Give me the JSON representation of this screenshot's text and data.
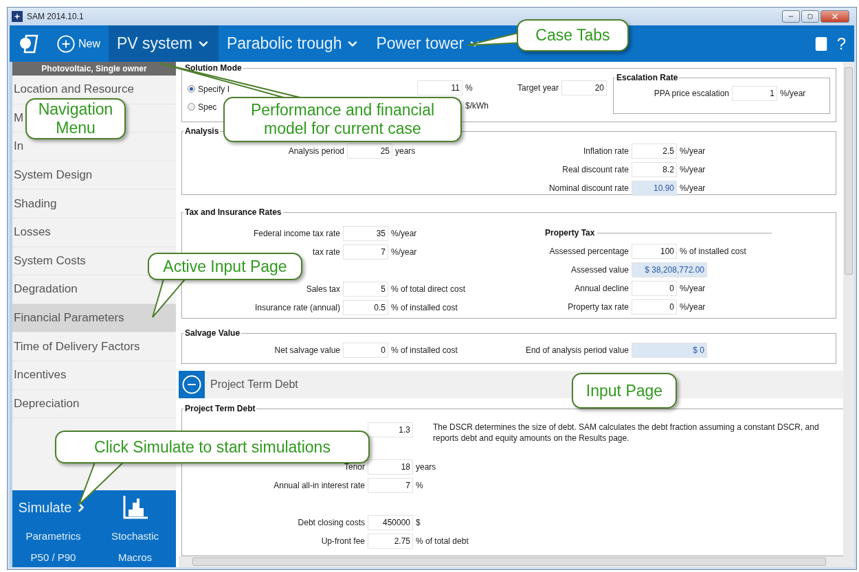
{
  "window": {
    "title": "SAM 2014.10.1"
  },
  "toolbar": {
    "new_label": "New",
    "help": "?",
    "cases": [
      {
        "label": "PV system",
        "selected": true
      },
      {
        "label": "Parabolic trough",
        "selected": false
      },
      {
        "label": "Power tower",
        "selected": false
      }
    ]
  },
  "sidebar": {
    "header": "Photovoltaic, Single owner",
    "items": [
      {
        "label": "Location and Resource",
        "selected": false
      },
      {
        "label": "M",
        "selected": false
      },
      {
        "label": "In",
        "selected": false
      },
      {
        "label": "System Design",
        "selected": false
      },
      {
        "label": "Shading",
        "selected": false
      },
      {
        "label": "Losses",
        "selected": false
      },
      {
        "label": "System Costs",
        "selected": false
      },
      {
        "label": "Degradation",
        "selected": false
      },
      {
        "label": "Financial Parameters",
        "selected": true
      },
      {
        "label": "Time of Delivery Factors",
        "selected": false
      },
      {
        "label": "Incentives",
        "selected": false
      },
      {
        "label": "Depreciation",
        "selected": false
      }
    ]
  },
  "simulate": {
    "label": "Simulate",
    "links": [
      "Parametrics",
      "Stochastic",
      "P50 / P90",
      "Macros"
    ]
  },
  "solution_mode": {
    "title": "Solution Mode",
    "options": [
      {
        "label": "Specify I",
        "selected": true
      },
      {
        "label": "Spec",
        "selected": false
      }
    ],
    "fields": [
      {
        "value": "11",
        "unit": "%"
      },
      {
        "unit": "$/kWh"
      }
    ],
    "target": {
      "label": "Target year",
      "value": "20"
    },
    "escalation": {
      "title": "Escalation Rate",
      "fields": [
        {
          "label": "PPA price escalation",
          "value": "1",
          "unit": "%/year"
        }
      ]
    }
  },
  "analysis": {
    "title": "Analysis",
    "left": [
      {
        "label": "Analysis period",
        "value": "25",
        "unit": "years"
      }
    ],
    "right": [
      {
        "label": "Inflation rate",
        "value": "2.5",
        "unit": "%/year",
        "computed": false
      },
      {
        "label": "Real discount rate",
        "value": "8.2",
        "unit": "%/year",
        "computed": false
      },
      {
        "label": "Nominal discount rate",
        "value": "10.90",
        "unit": "%/year",
        "computed": true
      }
    ]
  },
  "tax": {
    "title": "Tax and Insurance Rates",
    "left": [
      {
        "label": "Federal income tax rate",
        "value": "35",
        "unit": "%/year",
        "computed": false
      },
      {
        "label": "tax rate",
        "value": "7",
        "unit": "%/year",
        "computed": false
      },
      {
        "label": "Sales tax",
        "value": "5",
        "unit": "% of total direct cost",
        "computed": false
      },
      {
        "label": "Insurance rate (annual)",
        "value": "0.5",
        "unit": "% of installed cost",
        "computed": false
      }
    ],
    "property_tax": {
      "title": "Property Tax",
      "fields": [
        {
          "label": "Assessed percentage",
          "value": "100",
          "unit": "% of installed cost",
          "computed": false
        },
        {
          "label": "Assessed value",
          "value": "$ 38,208,772.00",
          "computed": true
        },
        {
          "label": "Annual decline",
          "value": "0",
          "unit": "%/year",
          "computed": false
        },
        {
          "label": "Property tax rate",
          "value": "0",
          "unit": "%/year",
          "computed": false
        }
      ]
    }
  },
  "salvage": {
    "title": "Salvage Value",
    "left": [
      {
        "label": "Net salvage value",
        "value": "0",
        "unit": "% of installed cost",
        "computed": false
      }
    ],
    "right": [
      {
        "label": "End of analysis period value",
        "value": "$ 0",
        "computed": true
      }
    ]
  },
  "debt_header": {
    "label": "Project Term Debt",
    "expanded": true
  },
  "debt": {
    "title": "Project Term Debt",
    "note": "The DSCR determines the size of debt. SAM calculates the debt fraction assuming a constant DSCR, and reports debt and equity amounts on the Results page.",
    "fields": [
      {
        "value": "1.3",
        "computed": false
      },
      {
        "label": "Tenor",
        "value": "18",
        "unit": "years",
        "computed": false
      },
      {
        "label": "Annual all-in interest rate",
        "value": "7",
        "unit": "%",
        "computed": false
      },
      {
        "label": "Debt closing costs",
        "value": "450000",
        "unit": "$",
        "computed": false
      },
      {
        "label": "Up-front fee",
        "value": "2.75",
        "unit": "% of total debt",
        "computed": false
      }
    ]
  },
  "callouts": [
    {
      "text": "Case Tabs"
    },
    {
      "text": "Navigation Menu"
    },
    {
      "text": "Performance and financial model for current case"
    },
    {
      "text": "Active Input Page"
    },
    {
      "text": "Input Page"
    },
    {
      "text": "Click Simulate to start simulations"
    }
  ]
}
